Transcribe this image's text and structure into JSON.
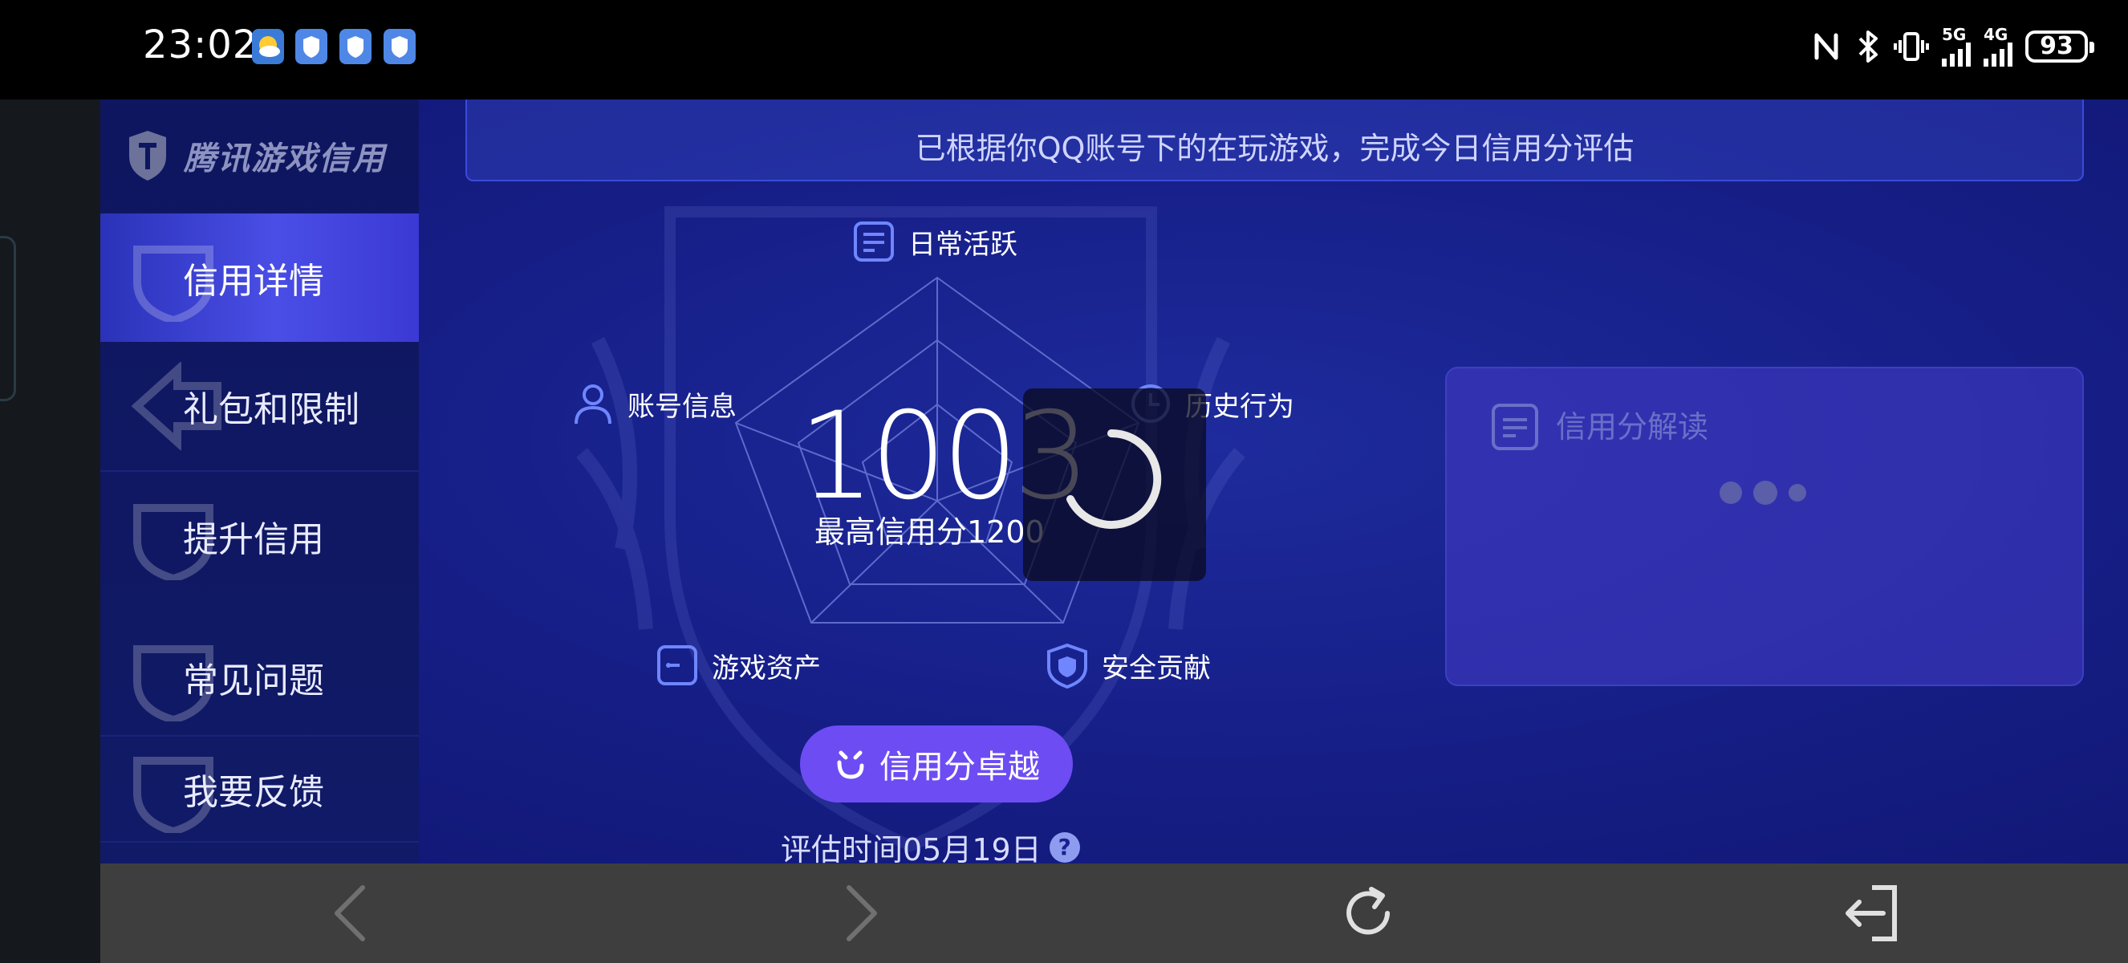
{
  "status_bar": {
    "time": "23:02",
    "signal_5g": "5G",
    "signal_4g": "4G",
    "battery": "93",
    "icons": [
      "nfc-icon",
      "bluetooth-icon",
      "vibrate-icon"
    ]
  },
  "sidebar": {
    "logo_text": "腾讯游戏信用",
    "items": [
      {
        "label": "信用详情",
        "active": true
      },
      {
        "label": "礼包和限制",
        "active": false
      },
      {
        "label": "提升信用",
        "active": false
      },
      {
        "label": "常见问题",
        "active": false
      },
      {
        "label": "我要反馈",
        "active": false
      }
    ]
  },
  "main": {
    "banner": "已根据你QQ账号下的在玩游戏，完成今日信用分评估",
    "radar_dimensions": {
      "daily_active": "日常活跃",
      "account_info": "账号信息",
      "history": "历史行为",
      "assets": "游戏资产",
      "security": "安全贡献"
    },
    "score": "1003",
    "max_score_text": "最高信用分1200",
    "level_button": "信用分卓越",
    "eval_time": "评估时间05月19日",
    "help_icon_text": "?"
  },
  "interpret_card": {
    "title": "信用分解读"
  },
  "colors": {
    "accent": "#6d4cf4",
    "active_nav": "#4a4ee6",
    "background": "#17208a"
  }
}
